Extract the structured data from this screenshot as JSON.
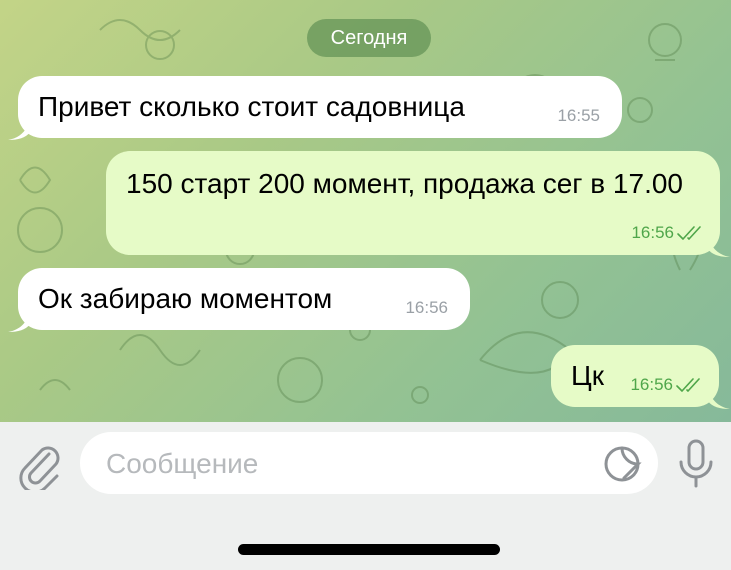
{
  "date_divider": "Сегодня",
  "messages": [
    {
      "direction": "incoming",
      "text": "Привет сколько стоит садовница",
      "time": "16:55"
    },
    {
      "direction": "outgoing",
      "text": "150 старт 200 момент, продажа сег в 17.00",
      "time": "16:56",
      "status": "read"
    },
    {
      "direction": "incoming",
      "text": "Ок забираю моментом",
      "time": "16:56"
    },
    {
      "direction": "outgoing",
      "text": "Цк",
      "time": "16:56",
      "status": "read"
    }
  ],
  "composer": {
    "placeholder": "Сообщение",
    "value": ""
  },
  "icons": {
    "attach": "paperclip-icon",
    "sticker": "sticker-icon",
    "voice": "microphone-icon",
    "read_status": "double-check-icon"
  },
  "colors": {
    "outgoing_bubble": "#e6fbc7",
    "incoming_bubble": "#ffffff",
    "read_ticks": "#4fa64a",
    "input_bar": "#eef0ef"
  }
}
